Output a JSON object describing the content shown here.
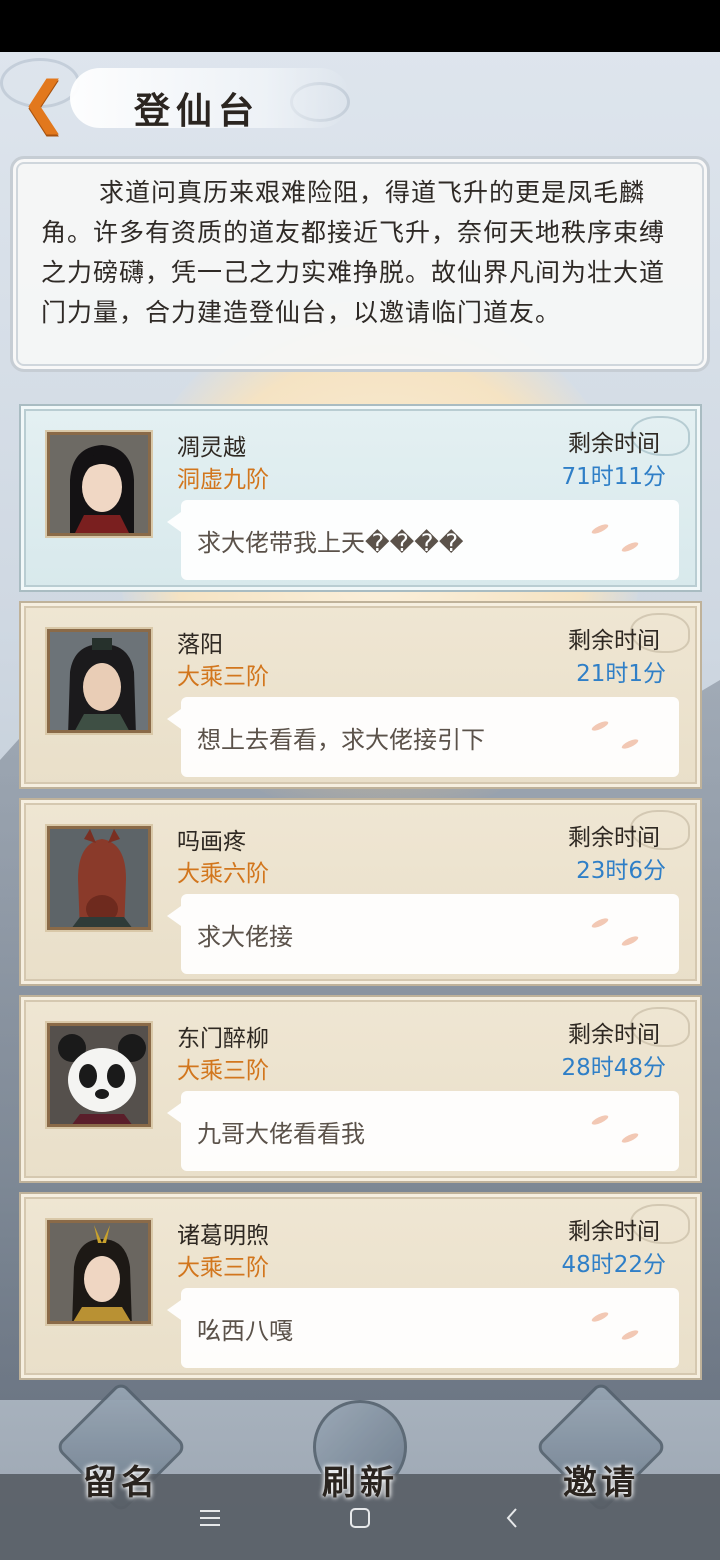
{
  "header": {
    "back_icon": "chevron-left-icon",
    "title": "登仙台"
  },
  "intro": {
    "text": "求道问真历来艰难险阻，得道飞升的更是凤毛麟角。许多有资质的道友都接近飞升，奈何天地秩序束缚之力磅礴，凭一己之力实难挣脱。故仙界凡间为壮大道门力量，合力建造登仙台，以邀请临门道友。"
  },
  "cards": [
    {
      "name": "凋灵越",
      "rank": "洞虚九阶",
      "time_label": "剩余时间",
      "time_value": "71时11分",
      "message": "求大佬带我上天����",
      "highlight": true
    },
    {
      "name": "落阳",
      "rank": "大乘三阶",
      "time_label": "剩余时间",
      "time_value": "21时1分",
      "message": "想上去看看，求大佬接引下"
    },
    {
      "name": "吗画疼",
      "rank": "大乘六阶",
      "time_label": "剩余时间",
      "time_value": "23时6分",
      "message": "求大佬接"
    },
    {
      "name": "东门醉柳",
      "rank": "大乘三阶",
      "time_label": "剩余时间",
      "time_value": "28时48分",
      "message": "九哥大佬看看我"
    },
    {
      "name": "诸葛明煦",
      "rank": "大乘三阶",
      "time_label": "剩余时间",
      "time_value": "48时22分",
      "message": "吆西八嘎"
    }
  ],
  "actions": {
    "leave_name": "留名",
    "refresh": "刷新",
    "invite": "邀请"
  },
  "colors": {
    "rank": "#d2761d",
    "time": "#2f7fc7",
    "back_arrow": "#e2781d"
  }
}
